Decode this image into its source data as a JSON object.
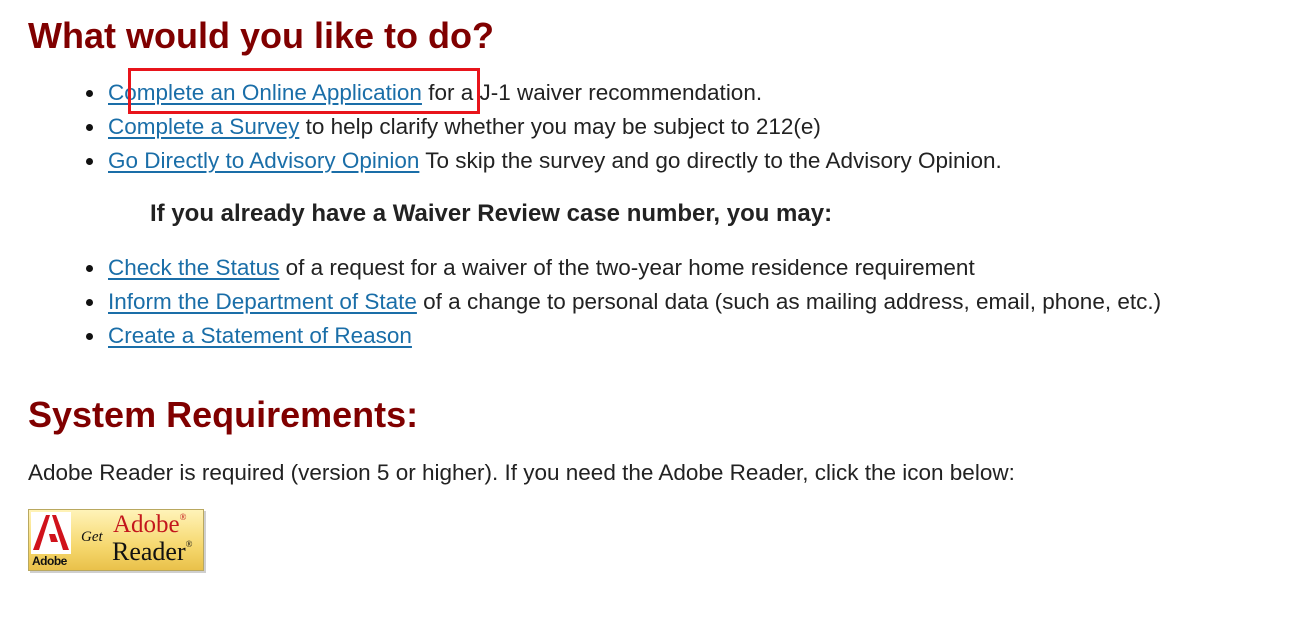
{
  "heading_main": "What would you like to do?",
  "actions": [
    {
      "link": "Complete an Online Application",
      "rest": " for a J-1 waiver recommendation."
    },
    {
      "link": "Complete a Survey",
      "rest": " to help clarify whether you may be subject to 212(e)"
    },
    {
      "link": "Go Directly to Advisory Opinion",
      "rest": " To skip the survey and go directly to the Advisory Opinion."
    }
  ],
  "case_subheading": "If you already have a Waiver Review case number, you may:",
  "case_actions": [
    {
      "link": "Check the Status",
      "rest": " of a request for a waiver of the two-year home residence requirement"
    },
    {
      "link": "Inform the Department of State",
      "rest": " of a change to personal data (such as mailing address, email, phone, etc.)"
    },
    {
      "link": "Create a Statement of Reason",
      "rest": ""
    }
  ],
  "heading_requirements": "System Requirements:",
  "requirements_text": "Adobe Reader is required (version 5 or higher). If you need the Adobe Reader, click the icon below:",
  "adobe_badge": {
    "logo_text": "Adobe",
    "get_text": "Get",
    "adobe_text": "Adobe",
    "reader_text": "Reader",
    "icon": "adobe-reader-icon"
  },
  "colors": {
    "heading": "#800000",
    "link": "#1a6ea8",
    "highlight": "#e8141b",
    "text": "#222222"
  }
}
